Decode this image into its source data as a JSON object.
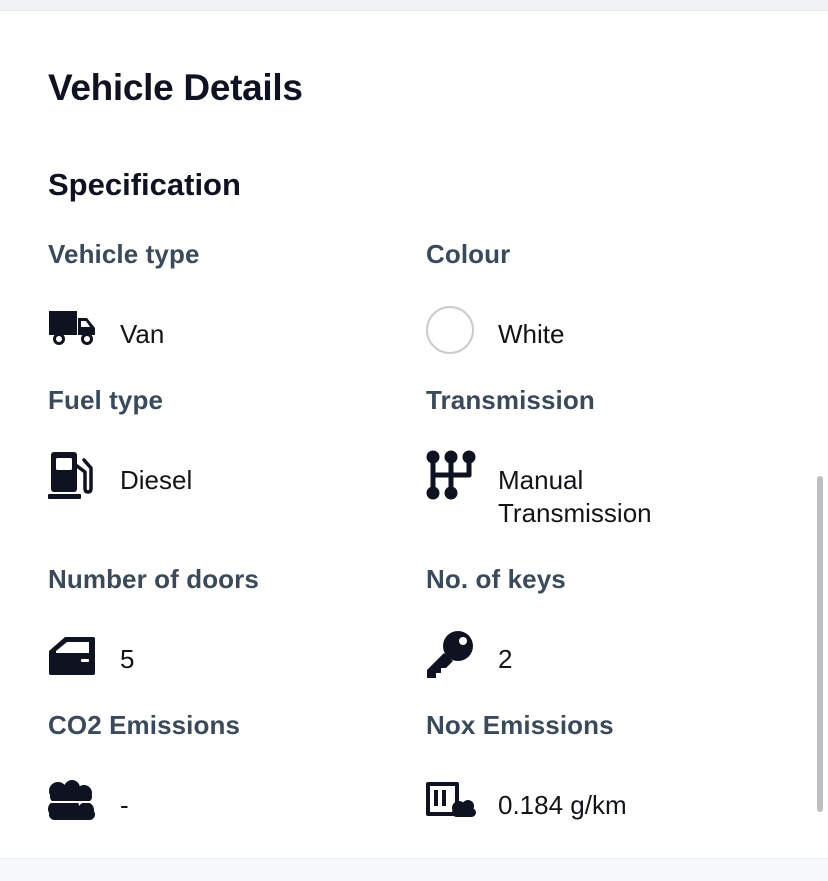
{
  "page": {
    "title": "Vehicle Details",
    "section_title": "Specification"
  },
  "specs": {
    "vehicle_type": {
      "label": "Vehicle type",
      "value": "Van",
      "icon": "van-icon"
    },
    "colour": {
      "label": "Colour",
      "value": "White",
      "icon": "colour-swatch-icon",
      "swatch_color": "#ffffff"
    },
    "fuel_type": {
      "label": "Fuel type",
      "value": "Diesel",
      "icon": "fuel-pump-icon"
    },
    "transmission": {
      "label": "Transmission",
      "value_line1": "Manual",
      "value_line2": "Transmission",
      "icon": "gear-shift-icon"
    },
    "doors": {
      "label": "Number of doors",
      "value": "5",
      "icon": "car-door-icon"
    },
    "keys": {
      "label": "No. of keys",
      "value": "2",
      "icon": "key-icon"
    },
    "co2": {
      "label": "CO2 Emissions",
      "value": "-",
      "icon": "clouds-icon"
    },
    "nox": {
      "label": "Nox Emissions",
      "value": "0.184 g/km",
      "icon": "factory-smoke-icon"
    }
  },
  "colors": {
    "heading": "#0f1220",
    "label": "#3a4a5a",
    "value": "#121417"
  }
}
